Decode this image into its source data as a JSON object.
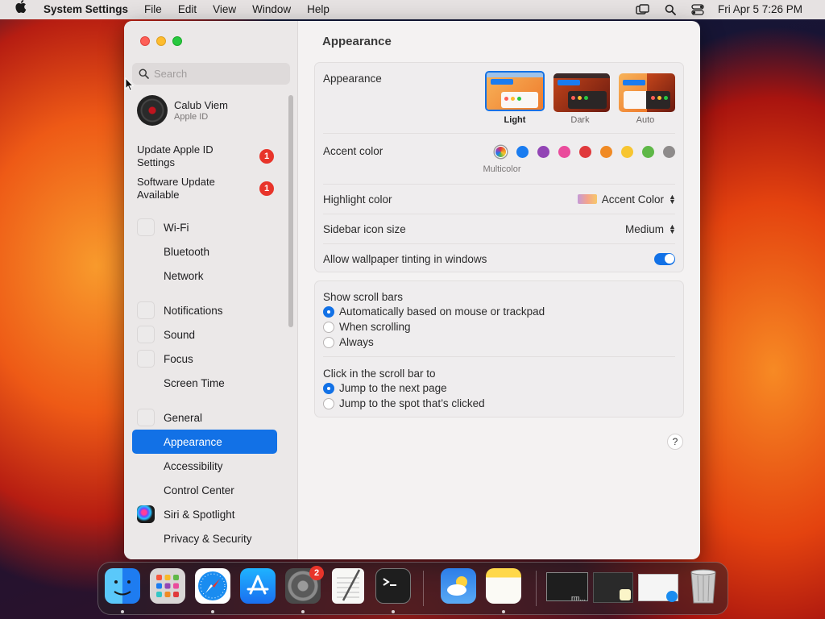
{
  "menubar": {
    "app_name": "System Settings",
    "menus": [
      "File",
      "Edit",
      "View",
      "Window",
      "Help"
    ],
    "clock": "Fri Apr 5  7:26 PM"
  },
  "sidebar": {
    "search_placeholder": "Search",
    "profile": {
      "name": "Calub Viem",
      "subtitle": "Apple ID"
    },
    "alerts": [
      {
        "label": "Update Apple ID Settings",
        "badge": "1"
      },
      {
        "label": "Software Update Available",
        "badge": "1"
      }
    ],
    "items": [
      {
        "label": "Wi-Fi",
        "icon": "wifi-icon"
      },
      {
        "label": "Bluetooth",
        "icon": "bluetooth-icon"
      },
      {
        "label": "Network",
        "icon": "network-icon"
      },
      {
        "label": "Notifications",
        "icon": "notifications-icon"
      },
      {
        "label": "Sound",
        "icon": "sound-icon"
      },
      {
        "label": "Focus",
        "icon": "focus-icon"
      },
      {
        "label": "Screen Time",
        "icon": "screen-time-icon"
      },
      {
        "label": "General",
        "icon": "general-icon"
      },
      {
        "label": "Appearance",
        "icon": "appearance-icon",
        "selected": true
      },
      {
        "label": "Accessibility",
        "icon": "accessibility-icon"
      },
      {
        "label": "Control Center",
        "icon": "control-center-icon"
      },
      {
        "label": "Siri & Spotlight",
        "icon": "siri-icon"
      },
      {
        "label": "Privacy & Security",
        "icon": "privacy-icon"
      }
    ]
  },
  "main": {
    "title": "Appearance",
    "appearance": {
      "label": "Appearance",
      "options": [
        "Light",
        "Dark",
        "Auto"
      ],
      "selected": "Light"
    },
    "accent": {
      "label": "Accent color",
      "selected_name": "Multicolor",
      "colors": [
        "multicolor",
        "#1a7cf0",
        "#9245b5",
        "#ea4c9c",
        "#e0393c",
        "#f08a24",
        "#f7c531",
        "#5fb848",
        "#8e8b8b"
      ]
    },
    "highlight": {
      "label": "Highlight color",
      "value": "Accent Color"
    },
    "sidebar_icon_size": {
      "label": "Sidebar icon size",
      "value": "Medium"
    },
    "wallpaper_tinting": {
      "label": "Allow wallpaper tinting in windows",
      "on": true
    },
    "scroll_bars": {
      "label": "Show scroll bars",
      "options": [
        "Automatically based on mouse or trackpad",
        "When scrolling",
        "Always"
      ],
      "selected": 0
    },
    "click_scroll": {
      "label": "Click in the scroll bar to",
      "options": [
        "Jump to the next page",
        "Jump to the spot that’s clicked"
      ],
      "selected": 0
    },
    "help": "?"
  },
  "dock": {
    "apps": [
      "Finder",
      "Launchpad",
      "Safari",
      "App Store",
      "System Settings",
      "TextEdit",
      "Terminal",
      "Weather",
      "Notes"
    ],
    "settings_badge": "2",
    "minimized_label": "rm..."
  }
}
